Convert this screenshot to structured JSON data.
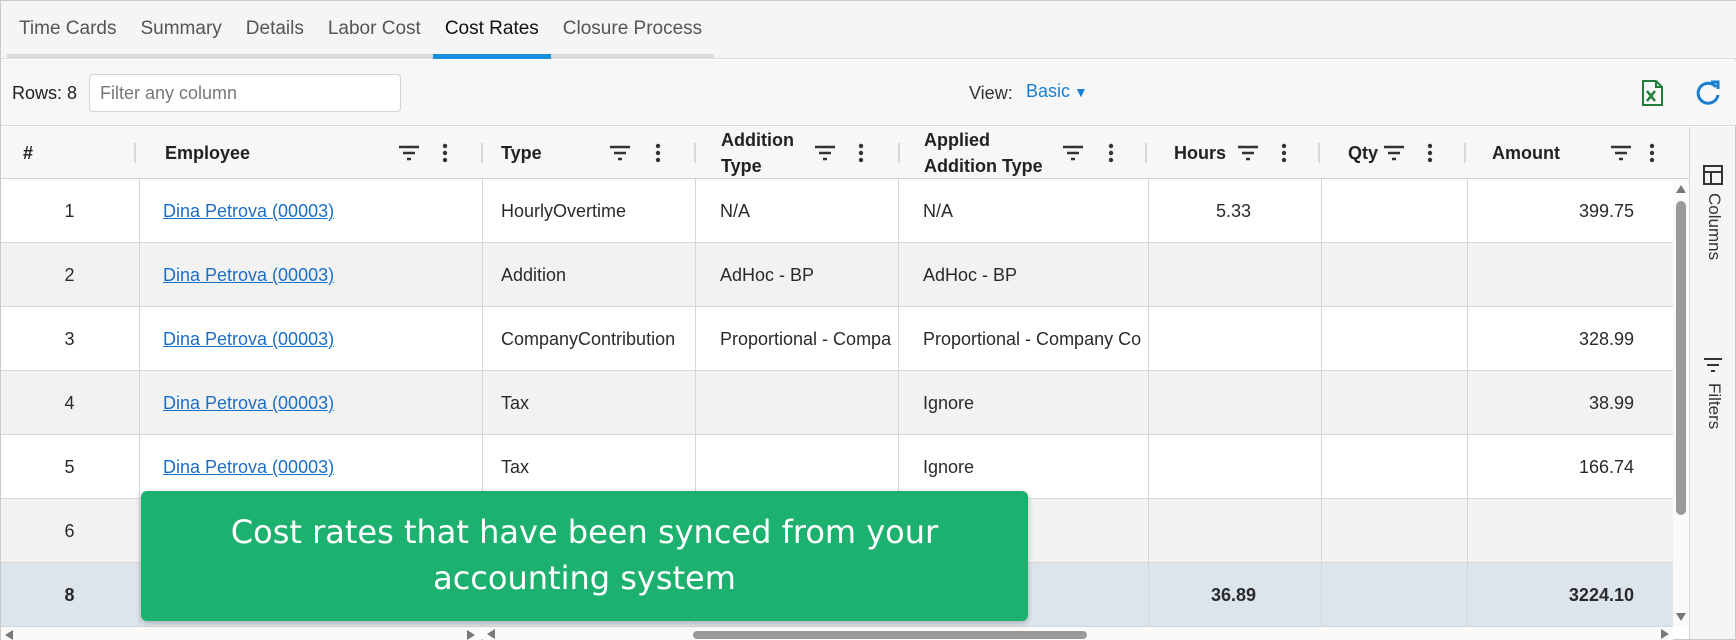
{
  "tabs": [
    {
      "label": "Time Cards",
      "active": false
    },
    {
      "label": "Summary",
      "active": false
    },
    {
      "label": "Details",
      "active": false
    },
    {
      "label": "Labor Cost",
      "active": false
    },
    {
      "label": "Cost Rates",
      "active": true
    },
    {
      "label": "Closure Process",
      "active": false
    }
  ],
  "toolbar": {
    "rows_label": "Rows: 8",
    "filter_placeholder": "Filter any column",
    "view_label": "View:",
    "view_value": "Basic",
    "export_icon": "excel-export-icon",
    "refresh_icon": "refresh-icon"
  },
  "grid": {
    "columns": [
      {
        "label": "#"
      },
      {
        "label": "Employee"
      },
      {
        "label": "Type"
      },
      {
        "label": "Addition Type"
      },
      {
        "label": "Applied Addition Type"
      },
      {
        "label": "Hours"
      },
      {
        "label": "Qty"
      },
      {
        "label": "Amount"
      }
    ],
    "rows": [
      {
        "num": "1",
        "employee": "Dina Petrova (00003)",
        "type": "HourlyOvertime",
        "addition_type": "N/A",
        "applied_addition_type": "N/A",
        "hours": "5.33",
        "qty": "",
        "amount": "399.75"
      },
      {
        "num": "2",
        "employee": "Dina Petrova (00003)",
        "type": "Addition",
        "addition_type": "AdHoc - BP",
        "applied_addition_type": "AdHoc - BP",
        "hours": "",
        "qty": "",
        "amount": ""
      },
      {
        "num": "3",
        "employee": "Dina Petrova (00003)",
        "type": "CompanyContribution",
        "addition_type": "Proportional - Compa",
        "applied_addition_type": "Proportional - Company Co",
        "hours": "",
        "qty": "",
        "amount": "328.99"
      },
      {
        "num": "4",
        "employee": "Dina Petrova (00003)",
        "type": "Tax",
        "addition_type": "",
        "applied_addition_type": "Ignore",
        "hours": "",
        "qty": "",
        "amount": "38.99"
      },
      {
        "num": "5",
        "employee": "Dina Petrova (00003)",
        "type": "Tax",
        "addition_type": "",
        "applied_addition_type": "Ignore",
        "hours": "",
        "qty": "",
        "amount": "166.74"
      },
      {
        "num": "6",
        "employee": "",
        "type": "",
        "addition_type": "",
        "applied_addition_type": "",
        "hours": "",
        "qty": "",
        "amount": ""
      }
    ],
    "total_row": {
      "num": "8",
      "hours": "36.89",
      "amount": "3224.10"
    }
  },
  "side_panel": {
    "columns_label": "Columns",
    "filters_label": "Filters"
  },
  "callout": {
    "text": "Cost rates that have been synced from your accounting system"
  },
  "colors": {
    "accent": "#1a8fe0",
    "link": "#1b6fc4",
    "callout_bg": "#1db170",
    "total_row_bg": "#dde5ec"
  }
}
